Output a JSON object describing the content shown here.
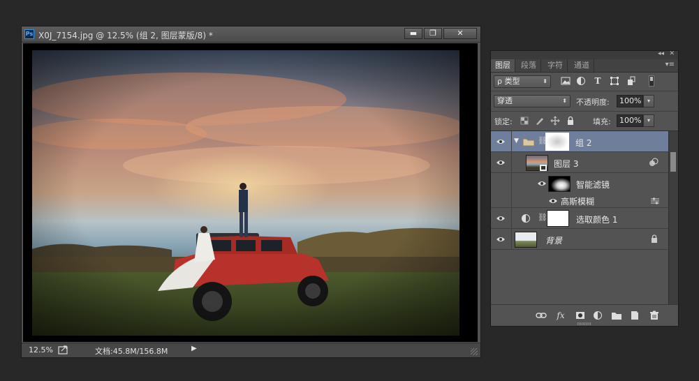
{
  "document": {
    "title": "X0J_7154.jpg @ 12.5% (组 2, 图层蒙版/8) *",
    "app_icon": "Ps",
    "zoom": "12.5%",
    "doc_size": "文档:45.8M/156.8M",
    "buttons": {
      "minimize": "▬",
      "maximize": "❐",
      "close": "✕"
    }
  },
  "layers_panel": {
    "tabs": [
      {
        "label": "图层",
        "active": true
      },
      {
        "label": "段落",
        "active": false
      },
      {
        "label": "字符",
        "active": false
      },
      {
        "label": "通道",
        "active": false
      }
    ],
    "filter_kind": "ρ 类型",
    "filter_icons": [
      "image-icon",
      "adjustment-icon",
      "type-icon",
      "shape-icon",
      "smart-object-icon"
    ],
    "blend_mode": "穿透",
    "opacity_label": "不透明度:",
    "opacity_value": "100%",
    "lock_label": "锁定:",
    "fill_label": "填充:",
    "fill_value": "100%",
    "layers": [
      {
        "name": "组 2",
        "type": "group",
        "selected": true
      },
      {
        "name": "图层 3",
        "type": "smart-object",
        "selected": false
      },
      {
        "name": "智能滤镜",
        "type": "smart-filter-mask",
        "selected": false
      },
      {
        "name": "高斯模糊",
        "type": "filter",
        "selected": false
      },
      {
        "name": "选取颜色 1",
        "type": "adjustment",
        "selected": false
      },
      {
        "name": "背景",
        "type": "background",
        "selected": false
      }
    ],
    "bottom_tools": [
      "link-icon",
      "fx-icon",
      "mask-icon",
      "adjustment-icon",
      "folder-icon",
      "new-layer-icon",
      "trash-icon"
    ]
  },
  "colors": {
    "selected_layer": "#6f7f9b",
    "panel_bg": "#535353",
    "app_bg": "#282828"
  }
}
